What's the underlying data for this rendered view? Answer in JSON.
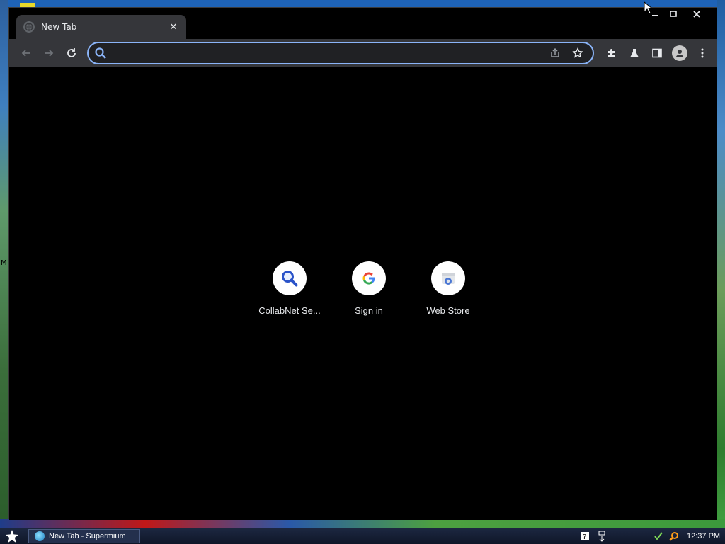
{
  "window": {
    "tab_title": "New Tab",
    "tab_close": "✕",
    "controls": {
      "minimize": "—",
      "maximize": "☐",
      "close": "✕"
    }
  },
  "toolbar": {
    "back_icon": "arrow-left-icon",
    "forward_icon": "arrow-right-icon",
    "reload_icon": "reload-icon",
    "omnibox_value": "",
    "omnibox_placeholder": "",
    "accent_color": "#8ab4f8"
  },
  "shortcuts": [
    {
      "label": "CollabNet Se...",
      "icon": "magnifier-icon"
    },
    {
      "label": "Sign in",
      "icon": "google-g-icon"
    },
    {
      "label": "Web Store",
      "icon": "web-store-icon"
    }
  ],
  "desktop": {
    "side_glyph": "M"
  },
  "taskbar": {
    "task_label": "New Tab - Supermium",
    "clock": "12:37 PM"
  }
}
